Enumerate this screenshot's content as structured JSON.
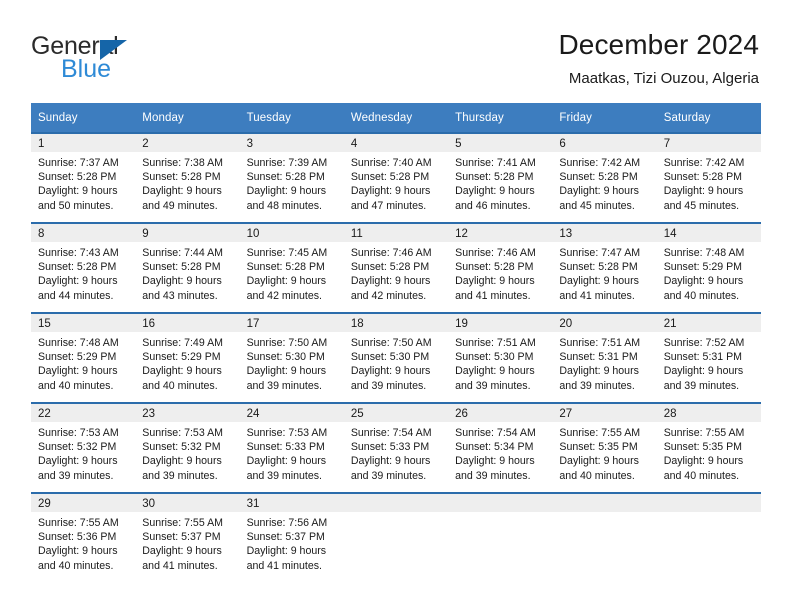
{
  "brand": {
    "name_dark": "General",
    "name_blue": "Blue",
    "triangle_icon": "blue-triangle-icon",
    "accent_blue": "#2e8ad6",
    "dark_blue": "#1565a8"
  },
  "header": {
    "title": "December 2024",
    "subtitle": "Maatkas, Tizi Ouzou, Algeria"
  },
  "calendar": {
    "header_bg": "#3d7dbf",
    "row_divider": "#2b6cab",
    "daynum_bg": "#eeeeee",
    "weekday_headers": [
      "Sunday",
      "Monday",
      "Tuesday",
      "Wednesday",
      "Thursday",
      "Friday",
      "Saturday"
    ],
    "weeks": [
      [
        {
          "day": "1",
          "sunrise": "Sunrise: 7:37 AM",
          "sunset": "Sunset: 5:28 PM",
          "daylight_line1": "Daylight: 9 hours",
          "daylight_line2": "and 50 minutes."
        },
        {
          "day": "2",
          "sunrise": "Sunrise: 7:38 AM",
          "sunset": "Sunset: 5:28 PM",
          "daylight_line1": "Daylight: 9 hours",
          "daylight_line2": "and 49 minutes."
        },
        {
          "day": "3",
          "sunrise": "Sunrise: 7:39 AM",
          "sunset": "Sunset: 5:28 PM",
          "daylight_line1": "Daylight: 9 hours",
          "daylight_line2": "and 48 minutes."
        },
        {
          "day": "4",
          "sunrise": "Sunrise: 7:40 AM",
          "sunset": "Sunset: 5:28 PM",
          "daylight_line1": "Daylight: 9 hours",
          "daylight_line2": "and 47 minutes."
        },
        {
          "day": "5",
          "sunrise": "Sunrise: 7:41 AM",
          "sunset": "Sunset: 5:28 PM",
          "daylight_line1": "Daylight: 9 hours",
          "daylight_line2": "and 46 minutes."
        },
        {
          "day": "6",
          "sunrise": "Sunrise: 7:42 AM",
          "sunset": "Sunset: 5:28 PM",
          "daylight_line1": "Daylight: 9 hours",
          "daylight_line2": "and 45 minutes."
        },
        {
          "day": "7",
          "sunrise": "Sunrise: 7:42 AM",
          "sunset": "Sunset: 5:28 PM",
          "daylight_line1": "Daylight: 9 hours",
          "daylight_line2": "and 45 minutes."
        }
      ],
      [
        {
          "day": "8",
          "sunrise": "Sunrise: 7:43 AM",
          "sunset": "Sunset: 5:28 PM",
          "daylight_line1": "Daylight: 9 hours",
          "daylight_line2": "and 44 minutes."
        },
        {
          "day": "9",
          "sunrise": "Sunrise: 7:44 AM",
          "sunset": "Sunset: 5:28 PM",
          "daylight_line1": "Daylight: 9 hours",
          "daylight_line2": "and 43 minutes."
        },
        {
          "day": "10",
          "sunrise": "Sunrise: 7:45 AM",
          "sunset": "Sunset: 5:28 PM",
          "daylight_line1": "Daylight: 9 hours",
          "daylight_line2": "and 42 minutes."
        },
        {
          "day": "11",
          "sunrise": "Sunrise: 7:46 AM",
          "sunset": "Sunset: 5:28 PM",
          "daylight_line1": "Daylight: 9 hours",
          "daylight_line2": "and 42 minutes."
        },
        {
          "day": "12",
          "sunrise": "Sunrise: 7:46 AM",
          "sunset": "Sunset: 5:28 PM",
          "daylight_line1": "Daylight: 9 hours",
          "daylight_line2": "and 41 minutes."
        },
        {
          "day": "13",
          "sunrise": "Sunrise: 7:47 AM",
          "sunset": "Sunset: 5:28 PM",
          "daylight_line1": "Daylight: 9 hours",
          "daylight_line2": "and 41 minutes."
        },
        {
          "day": "14",
          "sunrise": "Sunrise: 7:48 AM",
          "sunset": "Sunset: 5:29 PM",
          "daylight_line1": "Daylight: 9 hours",
          "daylight_line2": "and 40 minutes."
        }
      ],
      [
        {
          "day": "15",
          "sunrise": "Sunrise: 7:48 AM",
          "sunset": "Sunset: 5:29 PM",
          "daylight_line1": "Daylight: 9 hours",
          "daylight_line2": "and 40 minutes."
        },
        {
          "day": "16",
          "sunrise": "Sunrise: 7:49 AM",
          "sunset": "Sunset: 5:29 PM",
          "daylight_line1": "Daylight: 9 hours",
          "daylight_line2": "and 40 minutes."
        },
        {
          "day": "17",
          "sunrise": "Sunrise: 7:50 AM",
          "sunset": "Sunset: 5:30 PM",
          "daylight_line1": "Daylight: 9 hours",
          "daylight_line2": "and 39 minutes."
        },
        {
          "day": "18",
          "sunrise": "Sunrise: 7:50 AM",
          "sunset": "Sunset: 5:30 PM",
          "daylight_line1": "Daylight: 9 hours",
          "daylight_line2": "and 39 minutes."
        },
        {
          "day": "19",
          "sunrise": "Sunrise: 7:51 AM",
          "sunset": "Sunset: 5:30 PM",
          "daylight_line1": "Daylight: 9 hours",
          "daylight_line2": "and 39 minutes."
        },
        {
          "day": "20",
          "sunrise": "Sunrise: 7:51 AM",
          "sunset": "Sunset: 5:31 PM",
          "daylight_line1": "Daylight: 9 hours",
          "daylight_line2": "and 39 minutes."
        },
        {
          "day": "21",
          "sunrise": "Sunrise: 7:52 AM",
          "sunset": "Sunset: 5:31 PM",
          "daylight_line1": "Daylight: 9 hours",
          "daylight_line2": "and 39 minutes."
        }
      ],
      [
        {
          "day": "22",
          "sunrise": "Sunrise: 7:53 AM",
          "sunset": "Sunset: 5:32 PM",
          "daylight_line1": "Daylight: 9 hours",
          "daylight_line2": "and 39 minutes."
        },
        {
          "day": "23",
          "sunrise": "Sunrise: 7:53 AM",
          "sunset": "Sunset: 5:32 PM",
          "daylight_line1": "Daylight: 9 hours",
          "daylight_line2": "and 39 minutes."
        },
        {
          "day": "24",
          "sunrise": "Sunrise: 7:53 AM",
          "sunset": "Sunset: 5:33 PM",
          "daylight_line1": "Daylight: 9 hours",
          "daylight_line2": "and 39 minutes."
        },
        {
          "day": "25",
          "sunrise": "Sunrise: 7:54 AM",
          "sunset": "Sunset: 5:33 PM",
          "daylight_line1": "Daylight: 9 hours",
          "daylight_line2": "and 39 minutes."
        },
        {
          "day": "26",
          "sunrise": "Sunrise: 7:54 AM",
          "sunset": "Sunset: 5:34 PM",
          "daylight_line1": "Daylight: 9 hours",
          "daylight_line2": "and 39 minutes."
        },
        {
          "day": "27",
          "sunrise": "Sunrise: 7:55 AM",
          "sunset": "Sunset: 5:35 PM",
          "daylight_line1": "Daylight: 9 hours",
          "daylight_line2": "and 40 minutes."
        },
        {
          "day": "28",
          "sunrise": "Sunrise: 7:55 AM",
          "sunset": "Sunset: 5:35 PM",
          "daylight_line1": "Daylight: 9 hours",
          "daylight_line2": "and 40 minutes."
        }
      ],
      [
        {
          "day": "29",
          "sunrise": "Sunrise: 7:55 AM",
          "sunset": "Sunset: 5:36 PM",
          "daylight_line1": "Daylight: 9 hours",
          "daylight_line2": "and 40 minutes."
        },
        {
          "day": "30",
          "sunrise": "Sunrise: 7:55 AM",
          "sunset": "Sunset: 5:37 PM",
          "daylight_line1": "Daylight: 9 hours",
          "daylight_line2": "and 41 minutes."
        },
        {
          "day": "31",
          "sunrise": "Sunrise: 7:56 AM",
          "sunset": "Sunset: 5:37 PM",
          "daylight_line1": "Daylight: 9 hours",
          "daylight_line2": "and 41 minutes."
        },
        {
          "day": "",
          "sunrise": "",
          "sunset": "",
          "daylight_line1": "",
          "daylight_line2": ""
        },
        {
          "day": "",
          "sunrise": "",
          "sunset": "",
          "daylight_line1": "",
          "daylight_line2": ""
        },
        {
          "day": "",
          "sunrise": "",
          "sunset": "",
          "daylight_line1": "",
          "daylight_line2": ""
        },
        {
          "day": "",
          "sunrise": "",
          "sunset": "",
          "daylight_line1": "",
          "daylight_line2": ""
        }
      ]
    ]
  }
}
